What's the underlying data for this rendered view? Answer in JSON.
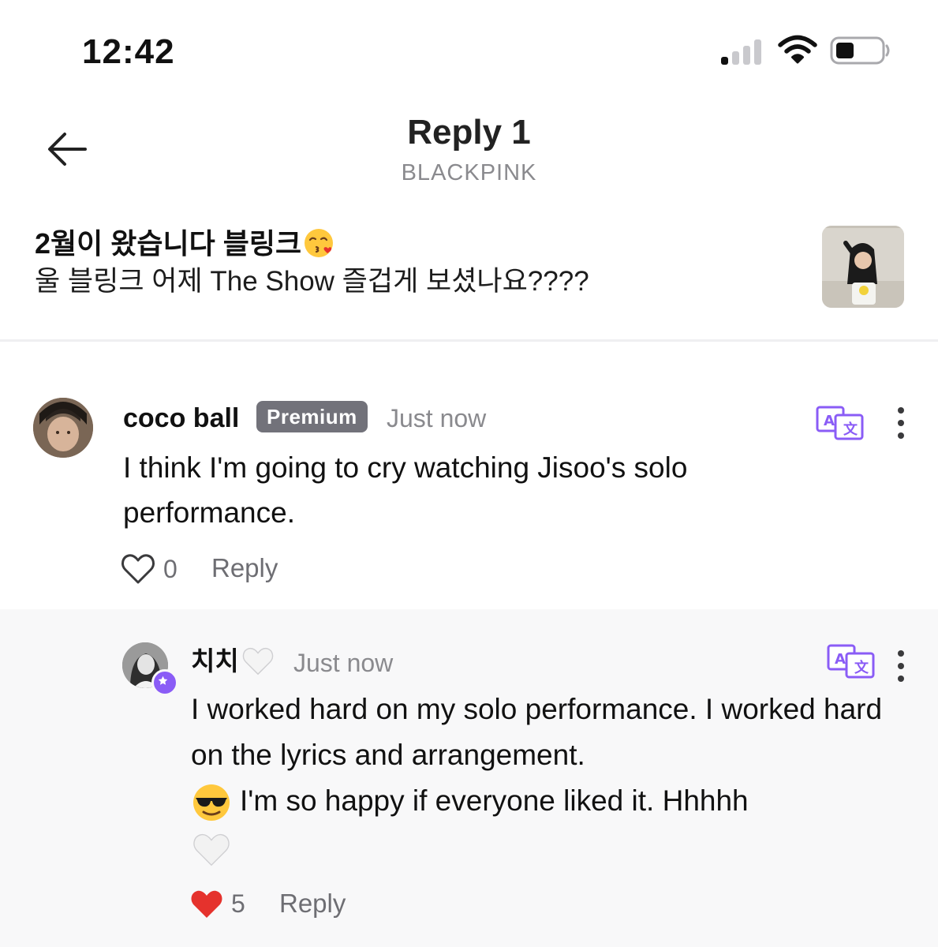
{
  "status_bar": {
    "time": "12:42"
  },
  "header": {
    "title": "Reply 1",
    "subtitle": "BLACKPINK"
  },
  "post": {
    "title": "2월이 왔습니다 블링크",
    "body": "울 블링크 어제 The Show 즐겁게 보셨나요????"
  },
  "comment": {
    "author": "coco ball",
    "badge": "Premium",
    "time": "Just now",
    "text": "I think I'm going to cry watching Jisoo's solo performance.",
    "likes": "0",
    "reply_label": "Reply"
  },
  "reply": {
    "author": "치치",
    "time": "Just now",
    "text_1": "I worked hard on my solo performance. I worked hard on the lyrics and arrangement.",
    "text_2": "I'm so happy if everyone liked it. Hhhhh",
    "likes": "5",
    "reply_label": "Reply"
  },
  "colors": {
    "accent": "#8a5cf6",
    "like": "#e5322d",
    "muted": "#8a8a8e"
  },
  "icons": [
    "back-arrow-icon",
    "translate-icon",
    "more-icon",
    "heart-outline-icon",
    "heart-filled-icon",
    "signal-icon",
    "wifi-icon",
    "battery-icon"
  ]
}
